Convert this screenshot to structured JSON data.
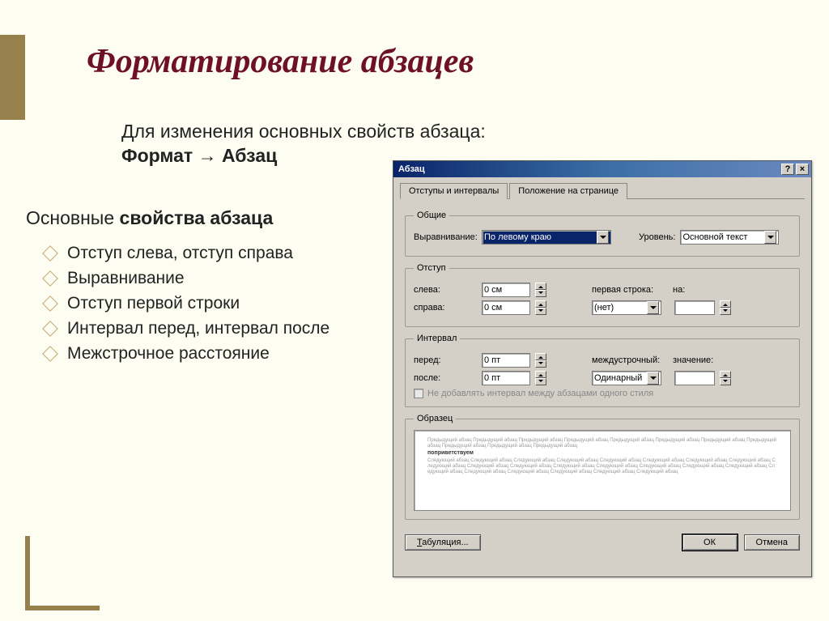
{
  "slide": {
    "title": "Форматирование абзацев",
    "subtitle_line1": "Для изменения основных свойств абзаца:",
    "subtitle_line2": "Формат → Абзац",
    "section_heading_prefix": "Основные ",
    "section_heading_strong": "свойства абзаца",
    "bullets": [
      "Отступ слева, отступ справа",
      "Выравнивание",
      "Отступ первой строки",
      "Интервал перед, интервал после",
      "Межстрочное расстояние"
    ]
  },
  "dialog": {
    "title": "Абзац",
    "help_btn": "?",
    "close_btn": "×",
    "tabs": [
      "Отступы и интервалы",
      "Положение на странице"
    ],
    "active_tab": 0,
    "group_general": {
      "legend": "Общие",
      "align_label": "Выравнивание:",
      "align_value": "По левому краю",
      "level_label": "Уровень:",
      "level_value": "Основной текст"
    },
    "group_indent": {
      "legend": "Отступ",
      "left_label": "слева:",
      "left_value": "0 см",
      "right_label": "справа:",
      "right_value": "0 см",
      "firstline_label": "первая строка:",
      "firstline_value": "(нет)",
      "on_label": "на:",
      "on_value": ""
    },
    "group_interval": {
      "legend": "Интервал",
      "before_label": "перед:",
      "before_value": "0 пт",
      "after_label": "после:",
      "after_value": "0 пт",
      "linespacing_label": "междустрочный:",
      "linespacing_value": "Одинарный",
      "value_label": "значение:",
      "value_value": "",
      "checkbox_label": "Не добавлять интервал между абзацами одного стиля"
    },
    "group_sample": {
      "legend": "Образец",
      "preview_prev": "Предыдущий абзац Предыдущий абзац Предыдущий абзац Предыдущий абзац Предыдущий абзац Предыдущий абзац Предыдущий абзац Предыдущий абзац Предыдущий абзац Предыдущий абзац Предыдущий абзац",
      "preview_current": "поприветствуем",
      "preview_next": "Следующий абзац Следующий абзац Следующий абзац Следующий абзац Следующий абзац Следующий абзац Следующий абзац Следующий абзац Следующий абзац Следующий абзац Следующий абзац Следующий абзац Следующий абзац Следующий абзац Следующий абзац Следующий абзац Следующий абзац Следующий абзац Следующий абзац Следующий абзац Следующий абзац Следующий абзац"
    },
    "buttons": {
      "tabstops": "Табуляция...",
      "ok": "ОК",
      "cancel": "Отмена"
    }
  }
}
